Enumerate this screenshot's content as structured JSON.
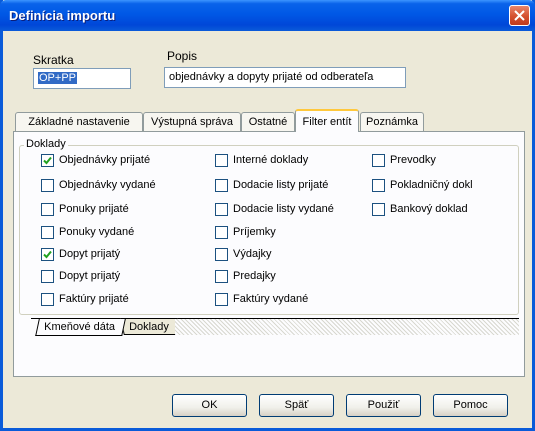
{
  "window": {
    "title": "Definícia importu"
  },
  "skratka": {
    "label": "Skratka",
    "value": "OP+PP"
  },
  "popis": {
    "label": "Popis",
    "value": "objednávky a dopyty prijaté od odberateľa"
  },
  "tabs": [
    "Základné nastavenie",
    "Výstupná správa",
    "Ostatné",
    "Filter entít",
    "Poznámka"
  ],
  "active_tab": "Filter entít",
  "group": {
    "label": "Doklady"
  },
  "checkboxes": [
    {
      "label": "Objednávky prijaté",
      "checked": true
    },
    {
      "label": "Objednávky vydané",
      "checked": false
    },
    {
      "label": "Ponuky prijaté",
      "checked": false
    },
    {
      "label": "Ponuky vydané",
      "checked": false
    },
    {
      "label": "Dopyt prijatý",
      "checked": true
    },
    {
      "label": "Dopyt prijatý",
      "checked": false
    },
    {
      "label": "Faktúry prijaté",
      "checked": false
    },
    {
      "label": "Interné doklady",
      "checked": false
    },
    {
      "label": "Dodacie listy prijaté",
      "checked": false
    },
    {
      "label": "Dodacie listy vydané",
      "checked": false
    },
    {
      "label": "Príjemky",
      "checked": false
    },
    {
      "label": "Výdajky",
      "checked": false
    },
    {
      "label": "Predajky",
      "checked": false
    },
    {
      "label": "Faktúry vydané",
      "checked": false
    },
    {
      "label": "Prevodky",
      "checked": false
    },
    {
      "label": "Pokladničný dokl",
      "checked": false
    },
    {
      "label": "Bankový doklad",
      "checked": false
    }
  ],
  "bottom_tabs": [
    "Kmeňové dáta",
    "Doklady"
  ],
  "buttons": {
    "ok": "OK",
    "back": "Späť",
    "apply": "Použiť",
    "help": "Pomoc"
  }
}
